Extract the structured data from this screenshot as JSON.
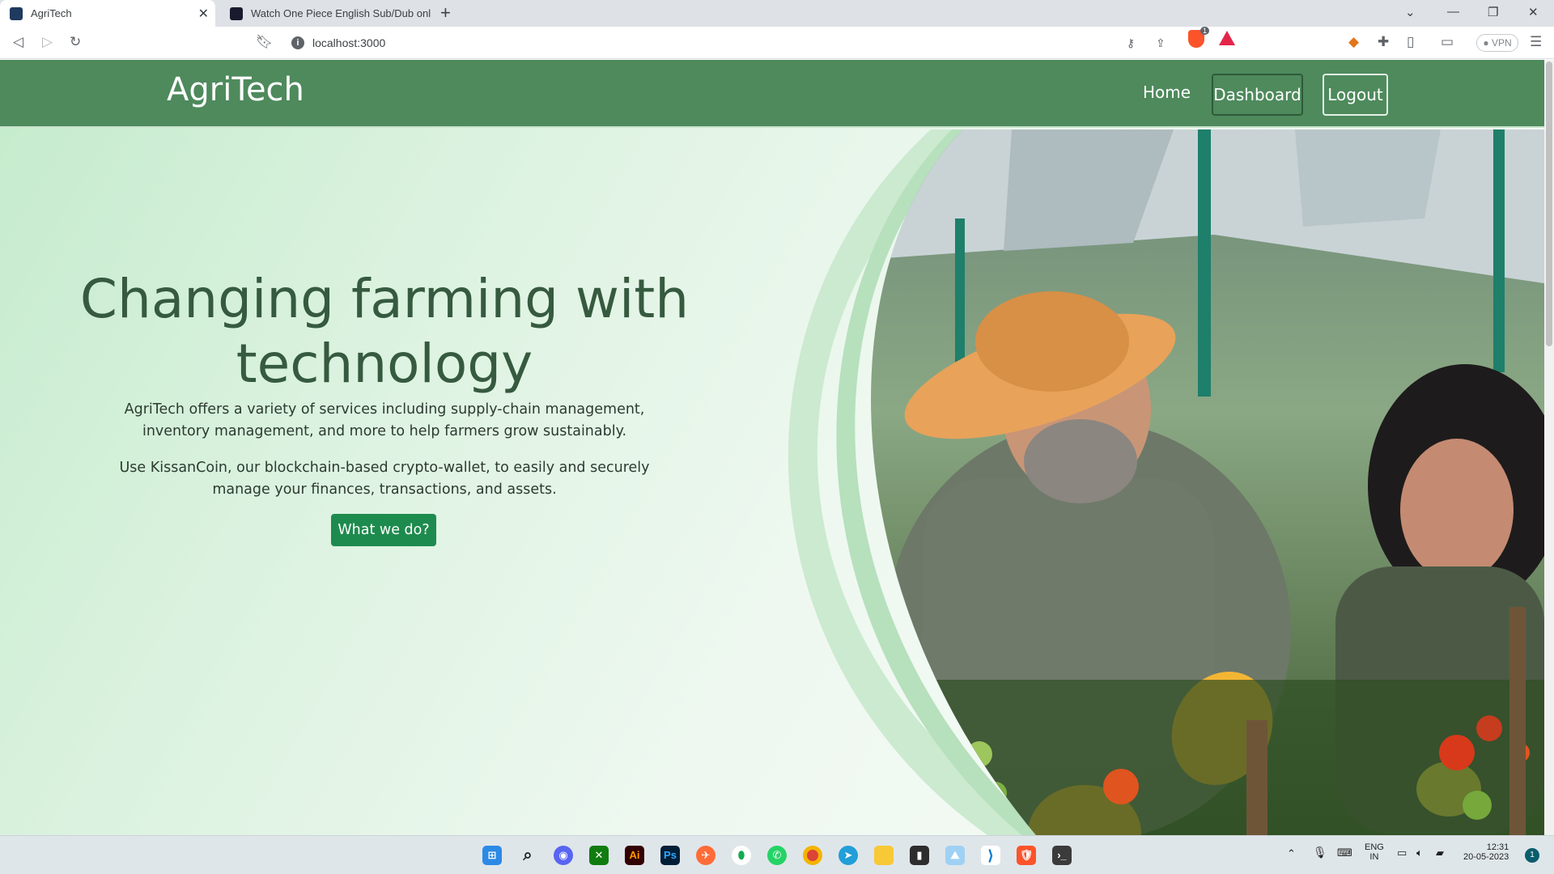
{
  "browser": {
    "tabs": [
      {
        "title": "AgriTech",
        "active": true
      },
      {
        "title": "Watch One Piece English Sub/Dub onl",
        "active": false
      }
    ],
    "new_tab": "+",
    "address": "localhost:3000",
    "vpn_label": "VPN",
    "shield_count": "1"
  },
  "site": {
    "brand": "AgriTech",
    "nav": {
      "home": "Home",
      "dashboard": "Dashboard",
      "logout": "Logout"
    },
    "hero": {
      "title_line1": "Changing farming with",
      "title_line2": "technology",
      "paragraph1": "AgriTech offers a variety of services including supply-chain management, inventory management, and more to help farmers grow sustainably.",
      "paragraph2": "Use KissanCoin, our blockchain-based crypto-wallet, to easily and securely manage your finances, transactions, and assets.",
      "cta": "What we do?"
    }
  },
  "taskbar": {
    "apps": [
      "windows-start",
      "search",
      "discord",
      "xbox",
      "illustrator",
      "photoshop",
      "postman",
      "mongodb",
      "whatsapp",
      "chrome",
      "telegram",
      "file-explorer",
      "terminal-dark",
      "photos",
      "vscode",
      "brave",
      "terminal"
    ],
    "illustrator_label": "Ai",
    "photoshop_label": "Ps",
    "language": "ENG",
    "region": "IN",
    "time": "12:31",
    "date": "20-05-2023",
    "notification_count": "1"
  },
  "colors": {
    "navbar": "#4e8a5c",
    "hero_title": "#365a3f",
    "cta": "#1e8b4e"
  }
}
